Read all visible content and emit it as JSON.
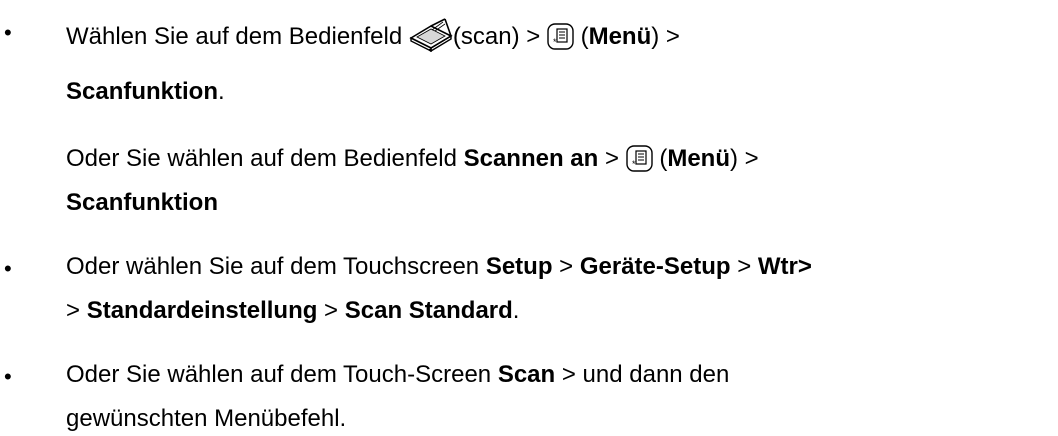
{
  "bullets": {
    "b1": "•",
    "b2": "•",
    "b3": "•"
  },
  "item1": {
    "line1_a": "Wählen Sie auf dem Bedienfeld ",
    "line1_b": "(scan) > ",
    "line1_c": " (",
    "menu_label_1": "Menü",
    "line1_d": ") >",
    "scanfunktion_1": "Scanfunktion",
    "period_1": ".",
    "line2_a": "Oder Sie wählen auf dem Bedienfeld ",
    "scannen_an": "Scannen an",
    "line2_b": " > ",
    "line2_c": " (",
    "menu_label_2": "Menü",
    "line2_d": ") >",
    "scanfunktion_2": "Scanfunktion"
  },
  "item2": {
    "a": "Oder wählen Sie auf dem Touchscreen ",
    "setup": "Setup",
    "b": " > ",
    "geraete_setup": "Geräte-Setup",
    "c": " > ",
    "wtr": "Wtr>",
    "d": "> ",
    "standardeinstellung": "Standardeinstellung",
    "e": " > ",
    "scan_standard": "Scan Standard",
    "f": "."
  },
  "item3": {
    "a": "Oder Sie wählen auf dem Touch-Screen ",
    "scan": "Scan",
    "b": " > und dann den",
    "c": "gewünschten Menübefehl."
  },
  "icons": {
    "scan": "scanner-icon",
    "menu": "menu-icon"
  }
}
